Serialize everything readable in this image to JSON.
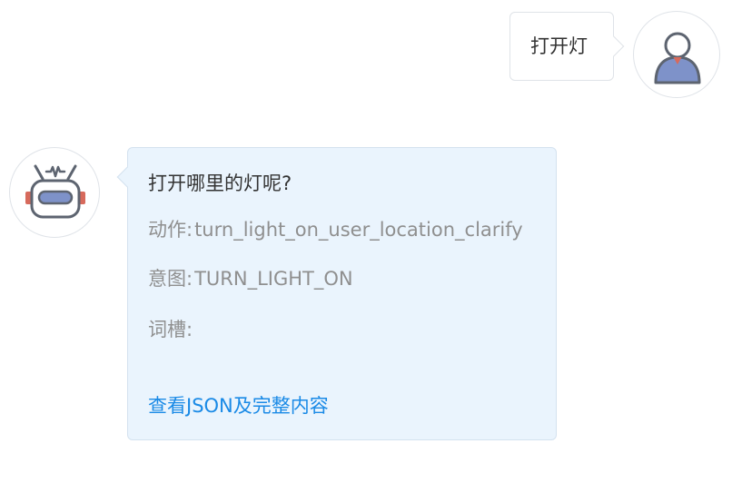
{
  "user_message": {
    "text": "打开灯",
    "avatar_icon": "user-icon"
  },
  "bot_message": {
    "avatar_icon": "robot-icon",
    "reply": "打开哪里的灯呢?",
    "fields": {
      "action_label": "动作:",
      "action_value": "turn_light_on_user_location_clarify",
      "intent_label": "意图:",
      "intent_value": "TURN_LIGHT_ON",
      "slots_label": "词槽:",
      "slots_value": ""
    },
    "link_text": "查看JSON及完整内容"
  },
  "colors": {
    "user_bubble_bg": "#ffffff",
    "bot_bubble_bg": "#eaf4fd",
    "link": "#1a8ae6",
    "muted_text": "#8f8f8f",
    "avatar_accent": "#7e92c9"
  }
}
